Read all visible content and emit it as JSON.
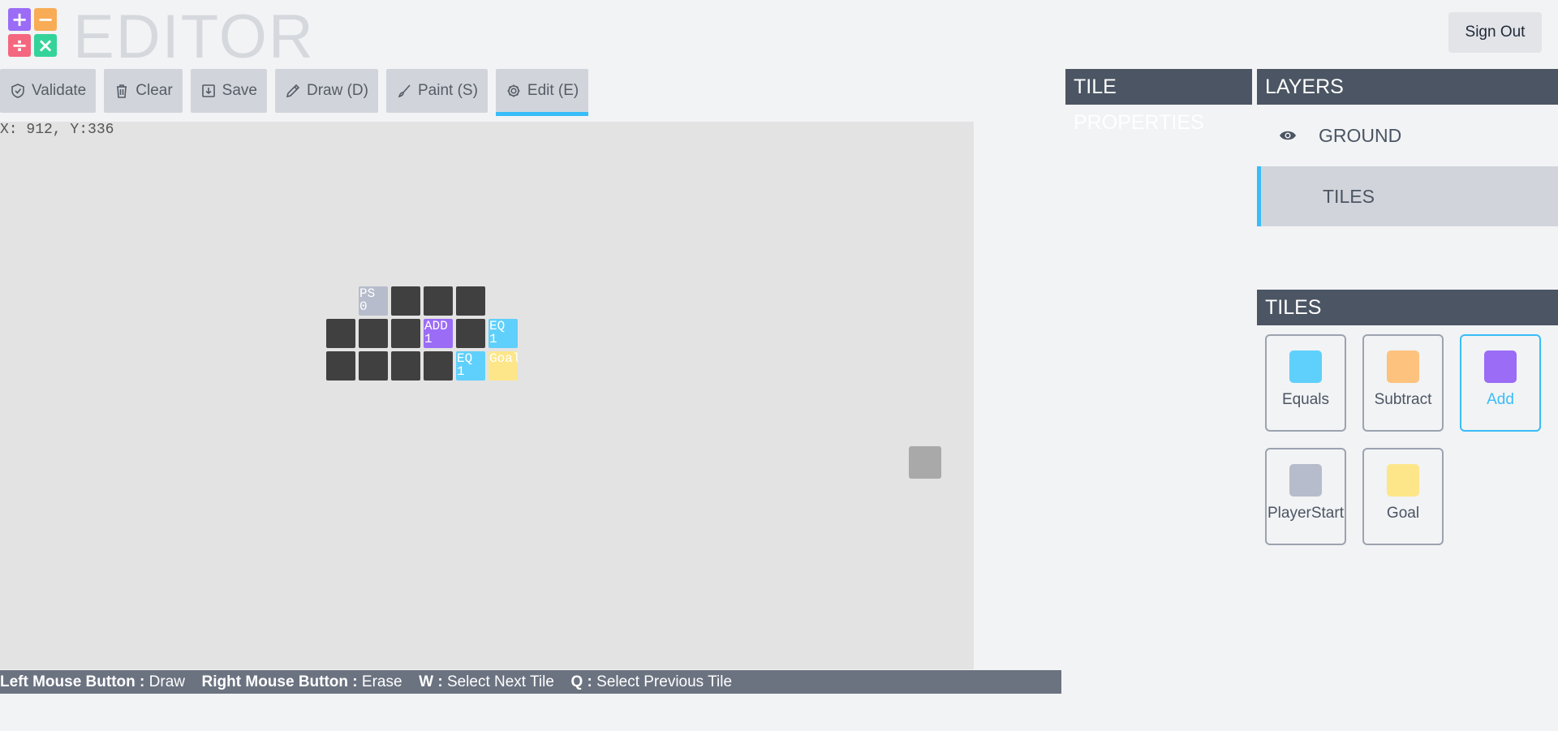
{
  "app": {
    "title": "EDITOR",
    "sign_out": "Sign Out"
  },
  "logo": [
    {
      "glyph": "+",
      "color": "#9b6cf6"
    },
    {
      "glyph": "−",
      "color": "#f8ac55"
    },
    {
      "glyph": "÷",
      "color": "#f4677e"
    },
    {
      "glyph": "×",
      "color": "#34d399"
    }
  ],
  "toolbar": {
    "validate": "Validate",
    "clear": "Clear",
    "save": "Save",
    "draw": "Draw (D)",
    "paint": "Paint (S)",
    "edit": "Edit (E)",
    "active": "edit"
  },
  "canvas": {
    "coords": "X: 912, Y:336",
    "labels": {
      "ps": "PS\n0",
      "add": "ADD\n1",
      "eq_top": "EQ\n1",
      "eq_bottom": "EQ\n1",
      "goal": "Goal"
    },
    "colors": {
      "dark": "#404040",
      "ps": "#b6bccb",
      "add": "#9b6cf6",
      "eq": "#5fd0fb",
      "goal": "#fde68a"
    }
  },
  "hints": {
    "lmb_key": "Left Mouse Button :",
    "lmb_action": "Draw",
    "rmb_key": "Right Mouse Button :",
    "rmb_action": "Erase",
    "w_key": "W :",
    "w_action": "Select Next Tile",
    "q_key": "Q :",
    "q_action": "Select Previous Tile"
  },
  "panels": {
    "tile_properties": "TILE PROPERTIES",
    "layers": "LAYERS",
    "tiles": "TILES"
  },
  "layers": [
    {
      "label": "GROUND",
      "visible": true
    },
    {
      "label": "TILES",
      "visible": false,
      "selected": true
    }
  ],
  "tiles": [
    {
      "label": "Equals",
      "color": "#5fd0fb"
    },
    {
      "label": "Subtract",
      "color": "#fdc27e"
    },
    {
      "label": "Add",
      "color": "#9b6cf6",
      "selected": true
    },
    {
      "label": "PlayerStart",
      "color": "#b6bccb"
    },
    {
      "label": "Goal",
      "color": "#fde68a"
    }
  ]
}
